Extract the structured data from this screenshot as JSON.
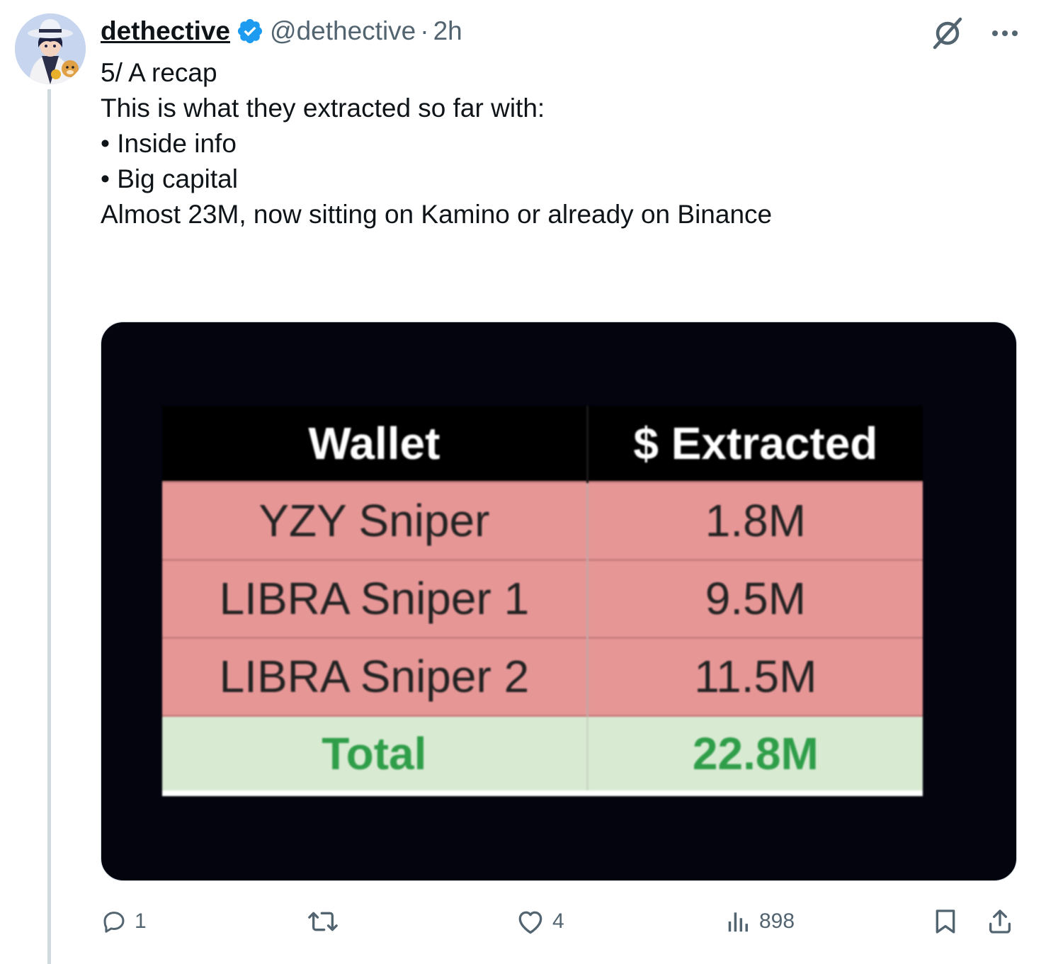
{
  "tweet": {
    "author": {
      "display_name": "dethective",
      "handle": "@dethective",
      "separator": "·",
      "time": "2h",
      "verified": true
    },
    "text_lines": [
      "5/ A recap",
      "",
      "This is what they extracted so far with:",
      "• Inside info",
      "• Big capital",
      "",
      "Almost 23M, now sitting on Kamino or already on Binance"
    ],
    "media": {
      "table": {
        "headers": [
          "Wallet",
          "$ Extracted"
        ],
        "rows": [
          [
            "YZY Sniper",
            "1.8M"
          ],
          [
            "LIBRA Sniper 1",
            "9.5M"
          ],
          [
            "LIBRA Sniper 2",
            "11.5M"
          ]
        ],
        "total": [
          "Total",
          "22.8M"
        ]
      },
      "colors": {
        "background": "#04040f",
        "header_bg": "#000000",
        "row_bg": "#e79696",
        "total_bg": "#d9ead3",
        "total_text": "#2f9e49"
      }
    },
    "metrics": {
      "replies": "1",
      "reposts": "",
      "likes": "4",
      "views": "898"
    },
    "icons": {
      "top": [
        "grok-icon",
        "more-icon"
      ],
      "actions": [
        "reply-icon",
        "repost-icon",
        "like-icon",
        "views-icon",
        "bookmark-icon",
        "share-icon"
      ]
    },
    "colors": {
      "verified": "#1d9bf0",
      "muted_text": "#536471",
      "thread_line": "#cfd9de"
    }
  }
}
